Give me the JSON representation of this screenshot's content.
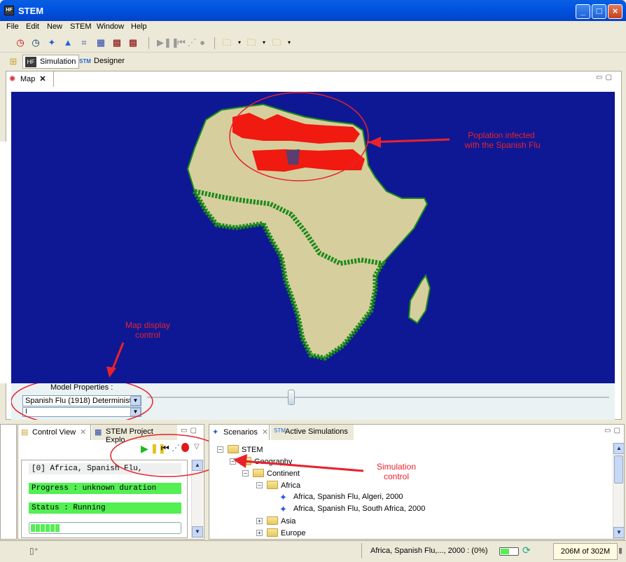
{
  "window": {
    "title": "STEM",
    "icon": "HF"
  },
  "menu": [
    "File",
    "Edit",
    "New",
    "STEM",
    "Window",
    "Help"
  ],
  "perspectives": {
    "simulation": "Simulation",
    "designer": "Designer"
  },
  "map_tab": {
    "label": "Map"
  },
  "annotations": {
    "infected": "Poplation infected\n with the Spanish Flu",
    "map_display": "Map display\ncontrol",
    "sim_control": "Simulation\ncontrol"
  },
  "model_properties": {
    "label": "Model Properties :",
    "selected": "Spanish Flu (1918) Deterministi",
    "second": "I"
  },
  "control_view": {
    "tabs": [
      "Control View",
      "STEM Project Explo"
    ],
    "sim_name": "[0] Africa, Spanish Flu,",
    "progress": "Progress : unknown duration",
    "status": "Status : Running",
    "progress_fill": 0.2
  },
  "scenarios": {
    "tabs": [
      "Scenarios",
      "Active Simulations"
    ],
    "tree": {
      "root": "STEM",
      "geography": "Geography",
      "continent": "Continent",
      "africa": "Africa",
      "item1": "Africa, Spanish Flu, Algeri, 2000",
      "item2": "Africa, Spanish Flu, South Africa, 2000",
      "asia": "Asia",
      "europe": "Europe"
    }
  },
  "status": {
    "sim": "Africa, Spanish Flu,..., 2000 : (0%)",
    "memory": "206M of 302M"
  },
  "colors": {
    "ocean": "#0f1894",
    "land": "#d6cf9d",
    "border": "#1c8a1c",
    "infected": "#f01a10",
    "progress": "#53ef53"
  }
}
